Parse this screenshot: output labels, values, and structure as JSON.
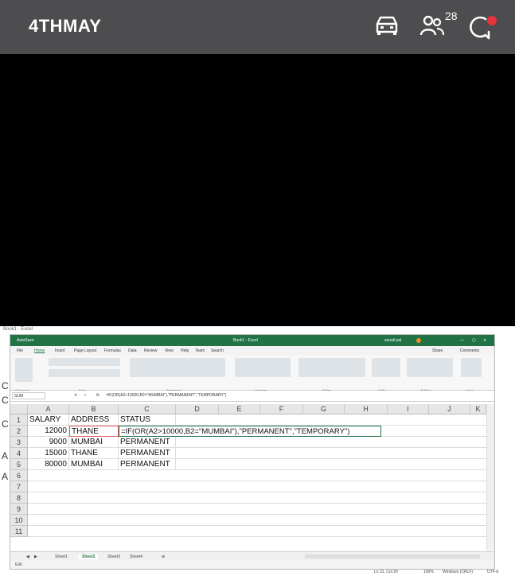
{
  "app": {
    "title": "4THMAY",
    "participants_count": "28",
    "colors": {
      "bar": "#4d4d4f",
      "video": "#000000",
      "notify_dot": "#e8323c",
      "excel_green": "#217346"
    }
  },
  "icons": {
    "car": "car-icon",
    "people": "people-icon",
    "chat": "chat-icon"
  },
  "excel": {
    "window_title": "Book1 - Excel",
    "autosave": "AutoSave",
    "user": "sonali pal",
    "menu": [
      "File",
      "Home",
      "Insert",
      "Page Layout",
      "Formulas",
      "Data",
      "Review",
      "View",
      "Help",
      "Team",
      "Search"
    ],
    "share": "Share",
    "comments": "Comments",
    "ribbon_groups": [
      "Clipboard",
      "Font",
      "Alignment",
      "Number",
      "Styles",
      "Cells",
      "Editing",
      "Ideas"
    ],
    "name_box": "SUM",
    "formula": "=IF(OR(A2>10000,B2=\"MUMBAI\"),\"PERMANENT\",\"TEMPORARY\")",
    "columns": [
      "A",
      "B",
      "C",
      "D",
      "E",
      "F",
      "G",
      "H",
      "I",
      "J",
      "K"
    ],
    "rows": [
      "1",
      "2",
      "3",
      "4",
      "5",
      "6",
      "7",
      "8",
      "9",
      "10",
      "11"
    ],
    "data": {
      "headers": [
        "SALARY",
        "ADDRESS",
        "STATUS"
      ],
      "r2": [
        "12000",
        "THANE",
        "=IF(OR(A2>10000,B2=\"MUMBAI\"),\"PERMANENT\",\"TEMPORARY\")"
      ],
      "r3": [
        "9000",
        "MUMBAI",
        "PERMANENT"
      ],
      "r4": [
        "15000",
        "THANE",
        "PERMANENT"
      ],
      "r5": [
        "80000",
        "MUMBAI",
        "PERMANENT"
      ]
    },
    "sheets": [
      "Sheet1",
      "Sheet2",
      "Sheet3",
      "Sheet4"
    ],
    "status": "Edit"
  },
  "taskbar": {
    "position": "Ln 31, Col 20",
    "zoom": "100%",
    "line_ending": "Windows (CRLF)",
    "encoding": "UTF-8"
  },
  "background_letters": [
    "C",
    "C",
    "C",
    "A",
    "A"
  ]
}
